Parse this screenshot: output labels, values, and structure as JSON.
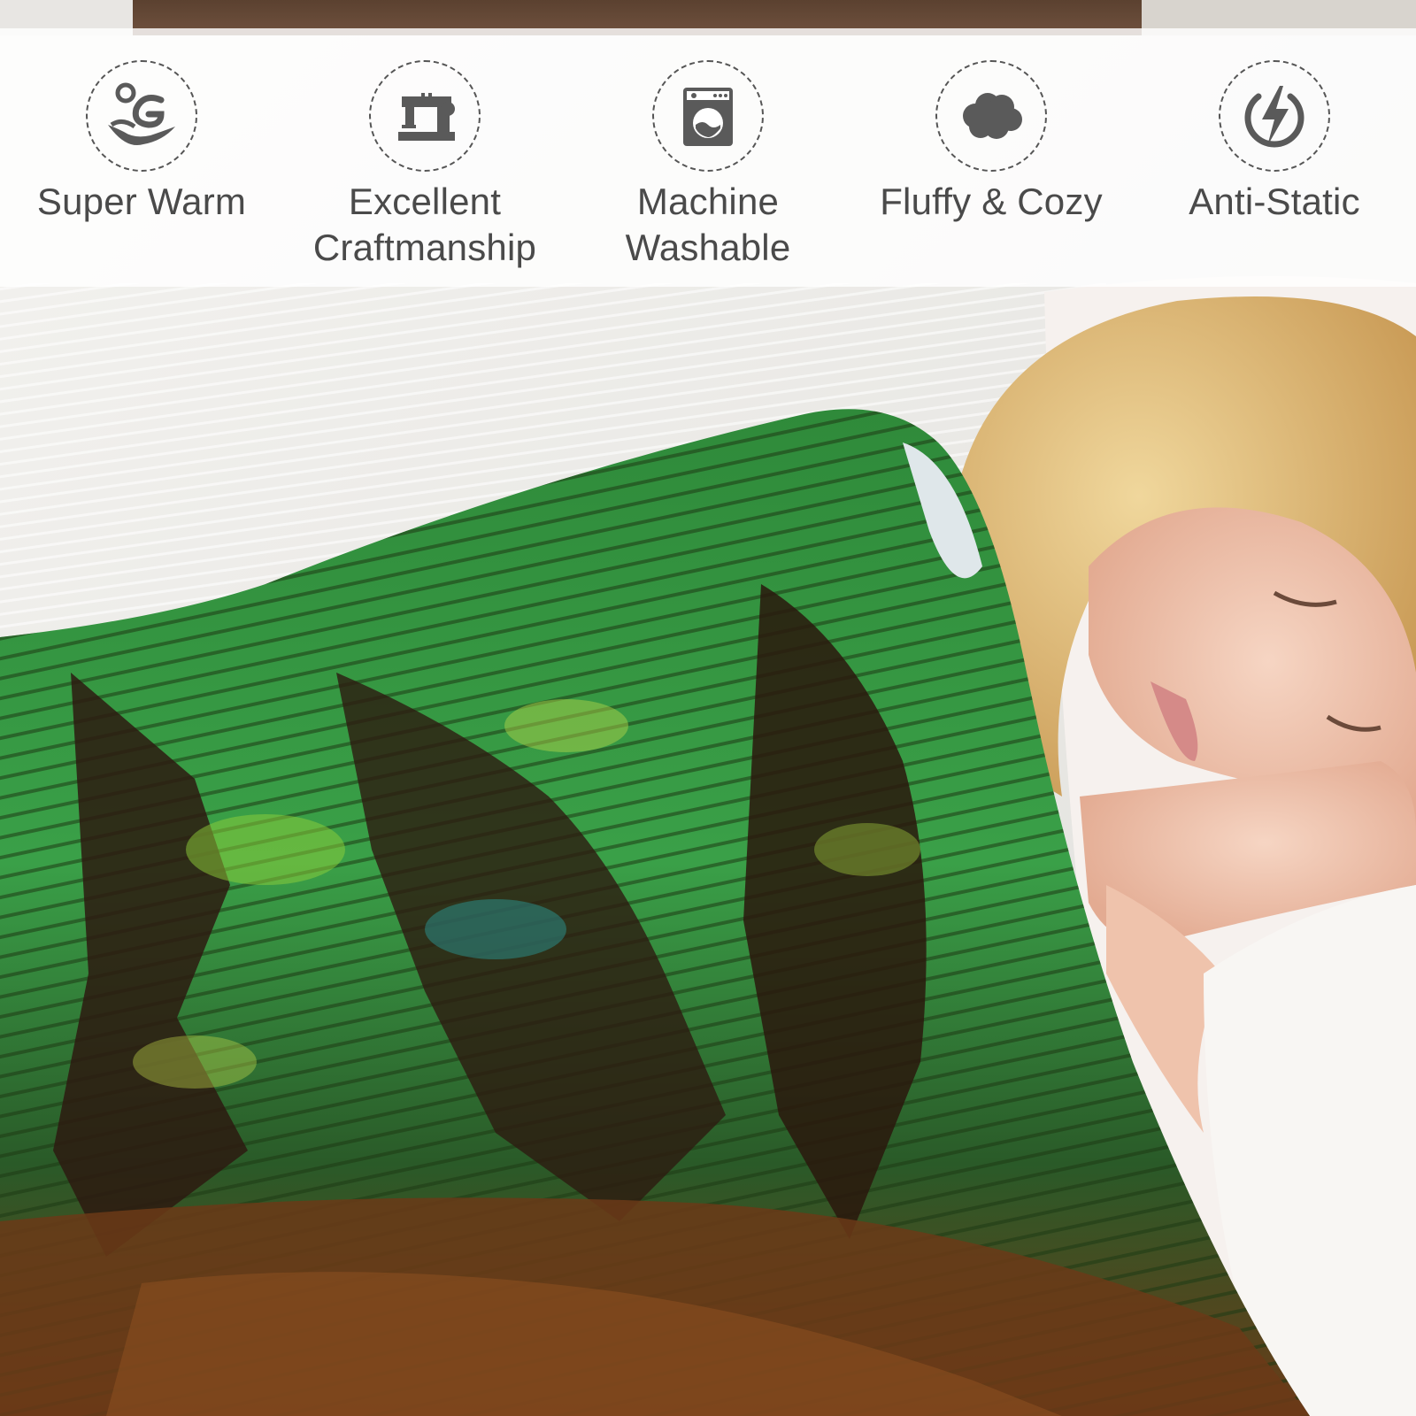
{
  "features": [
    {
      "icon": "warm-water-icon",
      "line1": "Super Warm",
      "line2": ""
    },
    {
      "icon": "sewing-machine-icon",
      "line1": "Excellent",
      "line2": "Craftmanship"
    },
    {
      "icon": "washing-machine-icon",
      "line1": "Machine",
      "line2": "Washable"
    },
    {
      "icon": "cloud-icon",
      "line1": "Fluffy & Cozy",
      "line2": ""
    },
    {
      "icon": "lightning-bolt-icon",
      "line1": "Anti-Static",
      "line2": ""
    }
  ],
  "colors": {
    "icon": "#5a5a5a",
    "label": "#4a4a4a",
    "blanket_green": "#3f9a3a",
    "blanket_brown": "#3a2216",
    "sheet": "#ecebe8",
    "skin": "#f1c9b4",
    "hair": "#e2c27f"
  }
}
